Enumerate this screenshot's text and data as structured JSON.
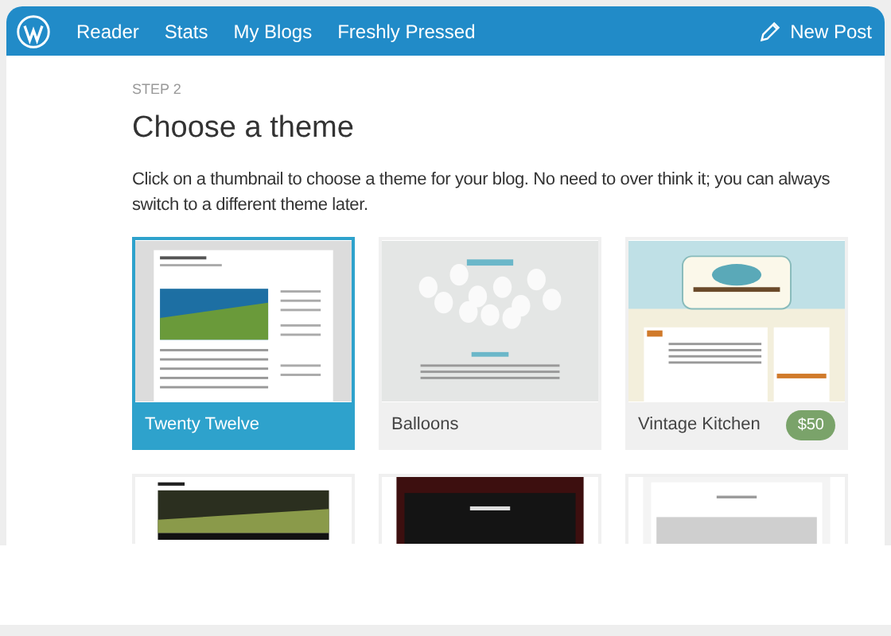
{
  "nav": {
    "items": [
      {
        "label": "Reader"
      },
      {
        "label": "Stats"
      },
      {
        "label": "My Blogs"
      },
      {
        "label": "Freshly Pressed"
      }
    ],
    "new_post": "New Post"
  },
  "step": "STEP 2",
  "title": "Choose a theme",
  "description": "Click on a thumbnail to choose a theme for your blog. No need to over think it; you can always switch to a different theme later.",
  "themes": [
    {
      "name": "Twenty Twelve",
      "selected": true,
      "kind": "blog"
    },
    {
      "name": "Balloons",
      "selected": false,
      "kind": "balloons"
    },
    {
      "name": "Vintage Kitchen",
      "selected": false,
      "kind": "kitchen",
      "price": "$50"
    }
  ],
  "more_themes": [
    {
      "kind": "forest"
    },
    {
      "kind": "dark"
    },
    {
      "kind": "light"
    }
  ]
}
